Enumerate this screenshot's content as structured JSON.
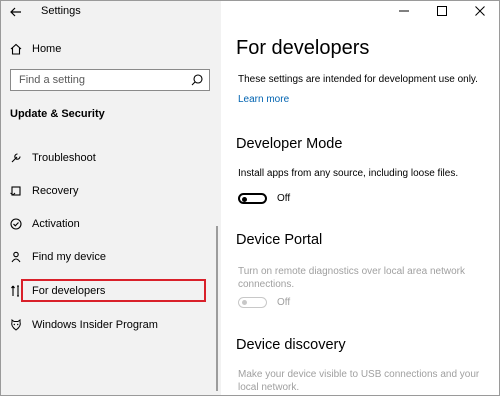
{
  "window": {
    "title": "Settings"
  },
  "sidebar": {
    "home_label": "Home",
    "search": {
      "placeholder": "Find a setting",
      "value": ""
    },
    "section_heading": "Update & Security",
    "items": [
      {
        "label": "Troubleshoot",
        "icon": "wrench-icon"
      },
      {
        "label": "Recovery",
        "icon": "recovery-icon"
      },
      {
        "label": "Activation",
        "icon": "activation-check-icon"
      },
      {
        "label": "Find my device",
        "icon": "person-pin-icon"
      },
      {
        "label": "For developers",
        "icon": "developer-tools-icon",
        "selected": true
      },
      {
        "label": "Windows Insider Program",
        "icon": "insider-cat-icon"
      }
    ],
    "selection_highlight_color": "#d9202a"
  },
  "content": {
    "title": "For developers",
    "intro": "These settings are intended for development use only.",
    "learn_more": "Learn more",
    "sections": [
      {
        "heading": "Developer Mode",
        "description": "Install apps from any source, including loose files.",
        "toggle_state": "Off",
        "enabled": true
      },
      {
        "heading": "Device Portal",
        "description": "Turn on remote diagnostics over local area network connections.",
        "toggle_state": "Off",
        "enabled": false
      },
      {
        "heading": "Device discovery",
        "description": "Make your device visible to USB connections and your local network.",
        "enabled": false
      }
    ]
  },
  "colors": {
    "link": "#0063b1",
    "sidebar_bg": "#f2f2f2",
    "disabled_text": "#a0a0a0"
  }
}
